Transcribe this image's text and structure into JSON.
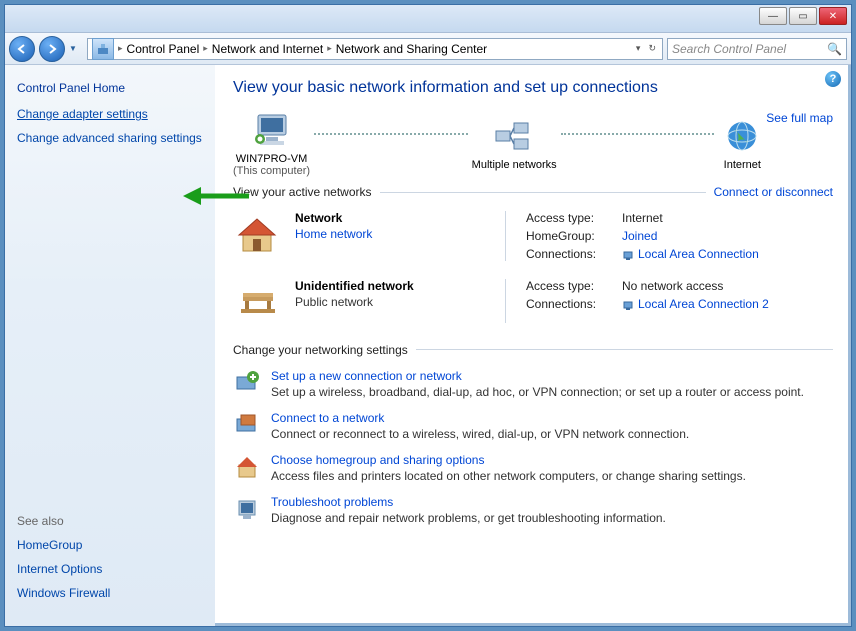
{
  "titlebar": {
    "min": "—",
    "max": "▭",
    "close": "✕"
  },
  "nav": {
    "back": "←",
    "forward": "→",
    "breadcrumbs": [
      "Control Panel",
      "Network and Internet",
      "Network and Sharing Center"
    ],
    "search_placeholder": "Search Control Panel"
  },
  "sidebar": {
    "home": "Control Panel Home",
    "links": [
      "Change adapter settings",
      "Change advanced sharing settings"
    ],
    "seealso_title": "See also",
    "seealso": [
      "HomeGroup",
      "Internet Options",
      "Windows Firewall"
    ]
  },
  "main": {
    "heading": "View your basic network information and set up connections",
    "full_map": "See full map",
    "map_nodes": [
      {
        "label": "WIN7PRO-VM",
        "sub": "(This computer)"
      },
      {
        "label": "Multiple networks",
        "sub": ""
      },
      {
        "label": "Internet",
        "sub": ""
      }
    ],
    "active_hdr": "View your active networks",
    "active_right": "Connect or disconnect",
    "networks": [
      {
        "name": "Network",
        "type": "Home network",
        "type_link": true,
        "props": [
          {
            "k": "Access type:",
            "v": "Internet",
            "link": false
          },
          {
            "k": "HomeGroup:",
            "v": "Joined",
            "link": true
          },
          {
            "k": "Connections:",
            "v": "Local Area Connection",
            "link": true,
            "icon": true
          }
        ]
      },
      {
        "name": "Unidentified network",
        "type": "Public network",
        "type_link": false,
        "props": [
          {
            "k": "Access type:",
            "v": "No network access",
            "link": false
          },
          {
            "k": "Connections:",
            "v": "Local Area Connection 2",
            "link": true,
            "icon": true
          }
        ]
      }
    ],
    "tasks_hdr": "Change your networking settings",
    "tasks": [
      {
        "title": "Set up a new connection or network",
        "desc": "Set up a wireless, broadband, dial-up, ad hoc, or VPN connection; or set up a router or access point."
      },
      {
        "title": "Connect to a network",
        "desc": "Connect or reconnect to a wireless, wired, dial-up, or VPN network connection."
      },
      {
        "title": "Choose homegroup and sharing options",
        "desc": "Access files and printers located on other network computers, or change sharing settings."
      },
      {
        "title": "Troubleshoot problems",
        "desc": "Diagnose and repair network problems, or get troubleshooting information."
      }
    ]
  }
}
